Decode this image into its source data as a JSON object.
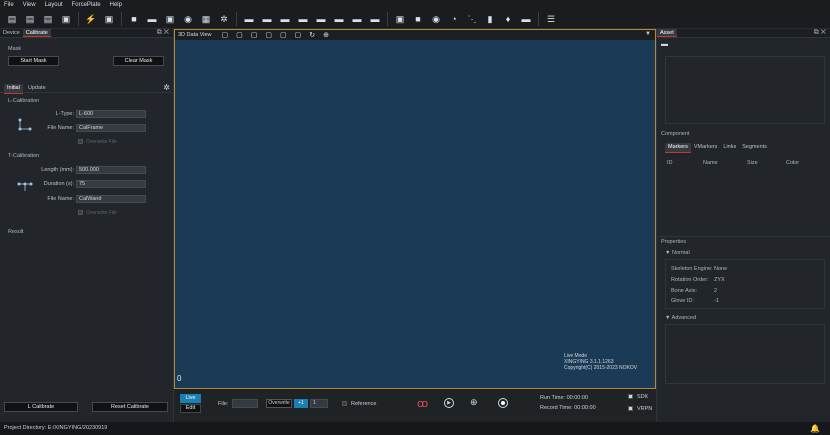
{
  "menu": [
    "File",
    "View",
    "Layout",
    "ForcePlate",
    "Help"
  ],
  "left": {
    "tabs": [
      "Device",
      "Calibrate"
    ],
    "mask": {
      "title": "Mask",
      "start": "Start Mask",
      "clear": "Clear Mask"
    },
    "subtabs": [
      "Initial",
      "Update"
    ],
    "lcal": {
      "title": "L-Calibration",
      "ltype_label": "L-Type:",
      "ltype": "L-600",
      "file_label": "File Name:",
      "file": "CalFrame",
      "overwrite": "Overwrite File"
    },
    "tcal": {
      "title": "T-Calibration",
      "length_label": "Length (mm):",
      "length": "500.000",
      "duration_label": "Duration (s):",
      "duration": "75",
      "file_label": "File Name:",
      "file": "CalWand",
      "overwrite": "Overwrite File"
    },
    "result": "Result",
    "lcal_btn": "L Calibrate",
    "reset_btn": "Reset Calibrate"
  },
  "center": {
    "view": "3D Data View",
    "info1": "Live Mode",
    "info2": "XINGYING 3.1.1.1263",
    "info3": "Copyright(C) 2015-2023 NOKOV",
    "frame": "0"
  },
  "bottom": {
    "live": "Live",
    "edit": "Edit",
    "file": "File:",
    "overwrite": "Overwrite",
    "plus": "+1",
    "num": "1",
    "reference": "Reference",
    "run": "Run Time: 00:00:00",
    "record": "Record Time: 00:00:00",
    "sdk": "SDK",
    "vrpn": "VRPN"
  },
  "right": {
    "asset": "Asset",
    "component": "Component",
    "tabs": [
      "Markers",
      "VMarkers",
      "Links",
      "Segments"
    ],
    "cols": [
      "ID",
      "Name",
      "Size",
      "Color"
    ],
    "properties": "Properties",
    "normal": "Normal",
    "advanced": "Advanced",
    "props": [
      [
        "Skeleton Engine:",
        "None"
      ],
      [
        "Rotation Order:",
        "ZYX"
      ],
      [
        "Bone Axis:",
        "2"
      ],
      [
        "Glove ID:",
        "-1"
      ]
    ]
  },
  "status": "Project Directory:  E:/XINGYING/20230919"
}
